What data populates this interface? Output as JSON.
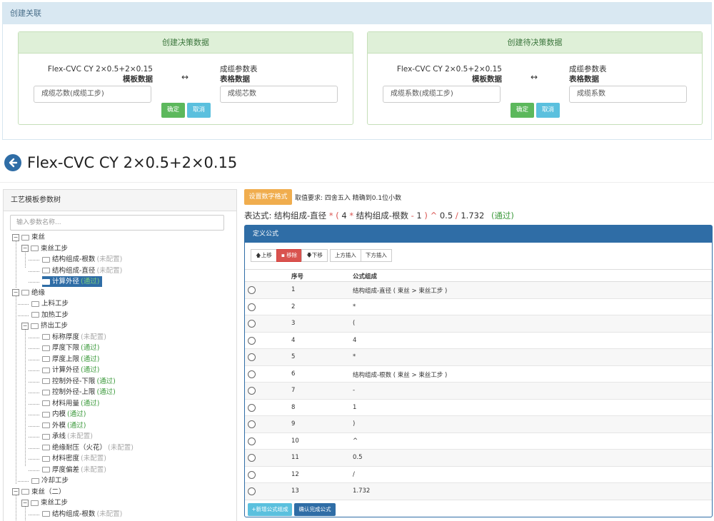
{
  "assoc": {
    "header": "创建关联",
    "panels": [
      {
        "title": "创建决策数据",
        "left_top": "Flex-CVC CY 2×0.5+2×0.15",
        "left_bold": "模板数据",
        "arrow": "↔",
        "right_top": "成缆参数表",
        "right_bold": "表格数据",
        "left_input": "成缆芯数(成缆工步)",
        "right_input": "成缆芯数",
        "ok": "确定",
        "cancel": "取消"
      },
      {
        "title": "创建待决策数据",
        "left_top": "Flex-CVC CY 2×0.5+2×0.15",
        "left_bold": "模板数据",
        "arrow": "↔",
        "right_top": "成缆参数表",
        "right_bold": "表格数据",
        "left_input": "成缆系数(成缆工步)",
        "right_input": "成缆系数",
        "ok": "确定",
        "cancel": "取消"
      }
    ]
  },
  "page_title": "Flex-CVC CY 2×0.5+2×0.15",
  "tree": {
    "header": "工艺模板参数树",
    "search_placeholder": "输入参数名称...",
    "nodes": [
      {
        "label": "束丝",
        "status": "",
        "st": ""
      },
      {
        "label": "束丝工步",
        "status": "",
        "st": ""
      },
      {
        "label": "结构组成-根数",
        "status": "(未配置)",
        "st": "n"
      },
      {
        "label": "结构组成-直径",
        "status": "(未配置)",
        "st": "n"
      },
      {
        "label": "计算外径",
        "status": "(通过)",
        "st": "g"
      },
      {
        "label": "绝缘",
        "status": "",
        "st": ""
      },
      {
        "label": "上料工步",
        "status": "",
        "st": ""
      },
      {
        "label": "加热工步",
        "status": "",
        "st": ""
      },
      {
        "label": "挤出工步",
        "status": "",
        "st": ""
      },
      {
        "label": "标称厚度",
        "status": "(未配置)",
        "st": "n"
      },
      {
        "label": "厚度下限",
        "status": "(通过)",
        "st": "g"
      },
      {
        "label": "厚度上限",
        "status": "(通过)",
        "st": "g"
      },
      {
        "label": "计算外径",
        "status": "(通过)",
        "st": "g"
      },
      {
        "label": "控制外径-下限",
        "status": "(通过)",
        "st": "g"
      },
      {
        "label": "控制外径-上限",
        "status": "(通过)",
        "st": "g"
      },
      {
        "label": "材料用量",
        "status": "(通过)",
        "st": "g"
      },
      {
        "label": "内模",
        "status": "(通过)",
        "st": "g"
      },
      {
        "label": "外模",
        "status": "(通过)",
        "st": "g"
      },
      {
        "label": "承线",
        "status": "(未配置)",
        "st": "n"
      },
      {
        "label": "绝缘耐压（火花）",
        "status": "(未配置)",
        "st": "n"
      },
      {
        "label": "材料密度",
        "status": "(未配置)",
        "st": "n"
      },
      {
        "label": "厚度偏差",
        "status": "(未配置)",
        "st": "n"
      },
      {
        "label": "冷却工步",
        "status": "",
        "st": ""
      },
      {
        "label": "束丝（二）",
        "status": "",
        "st": ""
      },
      {
        "label": "束丝工步",
        "status": "",
        "st": ""
      },
      {
        "label": "结构组成-根数",
        "status": "(未配置)",
        "st": "n"
      }
    ]
  },
  "format_button": "设置数字格式",
  "requirement": "取值要求:  四舍五入  精确到0.1位小数",
  "expression": {
    "prefix": "表达式:",
    "p1": "结构组成-直径",
    "o1": "*",
    "o2": "(",
    "p2": "4",
    "o3": "*",
    "p3": "结构组成-根数",
    "o4": "-",
    "p4": "1",
    "o5": ")",
    "o6": "^",
    "p5": "0.5",
    "o7": "/",
    "p6": "1.732",
    "status": "(通过)"
  },
  "formula": {
    "header": "定义公式",
    "toolbar": {
      "up": "上移",
      "del": "移除",
      "down": "下移",
      "ins_above": "上方插入",
      "ins_below": "下方插入"
    },
    "col_no": "序号",
    "col_formula": "公式组成",
    "rows": [
      {
        "no": "1",
        "f": "结构组成-直径 ( 束丝 > 束丝工步 )"
      },
      {
        "no": "2",
        "f": "*"
      },
      {
        "no": "3",
        "f": "("
      },
      {
        "no": "4",
        "f": "4"
      },
      {
        "no": "5",
        "f": "*"
      },
      {
        "no": "6",
        "f": "结构组成-根数 ( 束丝 > 束丝工步 )"
      },
      {
        "no": "7",
        "f": "-"
      },
      {
        "no": "8",
        "f": "1"
      },
      {
        "no": "9",
        "f": ")"
      },
      {
        "no": "10",
        "f": "^"
      },
      {
        "no": "11",
        "f": "0.5"
      },
      {
        "no": "12",
        "f": "/"
      },
      {
        "no": "13",
        "f": "1.732"
      }
    ],
    "add_button": "+新增公式组成",
    "confirm_button": "确认完成公式"
  },
  "colors": {
    "primary": "#2f6da6",
    "success": "#5cb85c",
    "info": "#5bc0de",
    "warning": "#f0ad4e",
    "danger": "#d9534f"
  }
}
